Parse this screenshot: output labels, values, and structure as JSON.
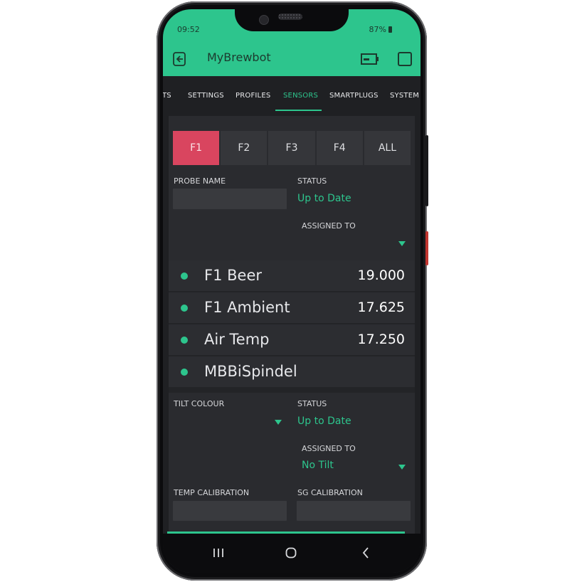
{
  "status_bar": {
    "time": "09:52",
    "battery": "87%"
  },
  "app_bar": {
    "title": "MyBrewbot"
  },
  "tabs": [
    {
      "label": "TS"
    },
    {
      "label": "SETTINGS"
    },
    {
      "label": "PROFILES"
    },
    {
      "label": "SENSORS",
      "active": true
    },
    {
      "label": "SMARTPLUGS"
    },
    {
      "label": "SYSTEM S"
    }
  ],
  "fermenter_selector": [
    "F1",
    "F2",
    "F3",
    "F4",
    "ALL"
  ],
  "probe_section": {
    "probe_name_label": "PROBE NAME",
    "probe_name_value": "",
    "status_label": "STATUS",
    "status_value": "Up to Date",
    "assigned_to_label": "ASSIGNED TO",
    "assigned_to_value": ""
  },
  "sensor_list": [
    {
      "name": "F1 Beer",
      "value": "19.000"
    },
    {
      "name": "F1 Ambient",
      "value": "17.625"
    },
    {
      "name": "Air Temp",
      "value": "17.250"
    },
    {
      "name": "MBBiSpindel",
      "value": ""
    }
  ],
  "tilt_section": {
    "tilt_colour_label": "TILT COLOUR",
    "tilt_colour_value": "",
    "status_label": "STATUS",
    "status_value": "Up to Date",
    "assigned_to_label": "ASSIGNED TO",
    "assigned_to_value": "No Tilt",
    "temp_cal_label": "TEMP CALIBRATION",
    "temp_cal_value": "",
    "sg_cal_label": "SG CALIBRATION",
    "sg_cal_value": ""
  },
  "colors": {
    "accent": "#2dc58d",
    "selected_fermenter": "#d9455f",
    "background": "#2a2b2f"
  },
  "icons": [
    "back-box-icon",
    "battery-icon",
    "square-icon",
    "recents-icon",
    "home-icon",
    "back-icon"
  ]
}
